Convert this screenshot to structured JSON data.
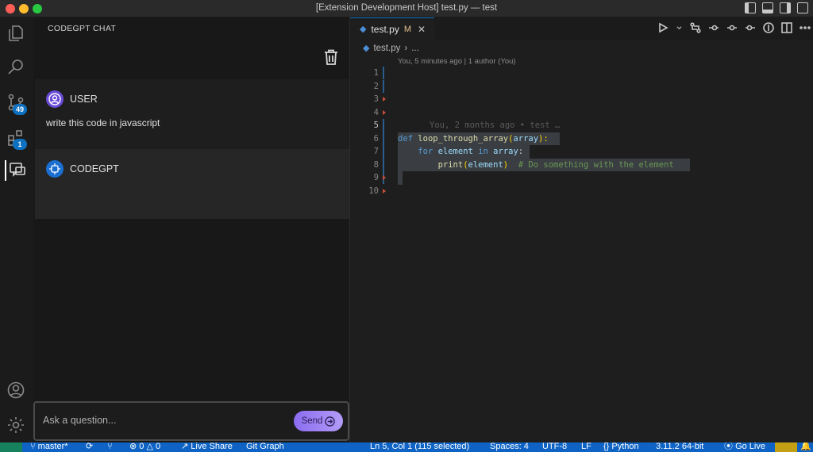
{
  "window": {
    "title": "[Extension Development Host] test.py — test"
  },
  "activity_bar": {
    "source_control_badge": "49",
    "extensions_badge": "1"
  },
  "chat_panel": {
    "title": "CODEGPT CHAT",
    "messages": [
      {
        "author": "USER",
        "text": "write this code in javascript"
      },
      {
        "author": "CODEGPT",
        "text": ""
      }
    ],
    "input_placeholder": "Ask a question...",
    "send_label": "Send"
  },
  "editor": {
    "tab": {
      "filename": "test.py",
      "modified_marker": "M"
    },
    "breadcrumb": {
      "file": "test.py",
      "rest": "..."
    },
    "blame_header": "You, 5 minutes ago | 1 author (You)",
    "inline_blame": "You, 2 months ago • test …",
    "line_numbers": [
      "1",
      "2",
      "3",
      "4",
      "5",
      "6",
      "7",
      "8",
      "9",
      "10"
    ],
    "code_lines": {
      "l6": {
        "kw": "def",
        "fn": "loop_through_array",
        "open": "(",
        "param": "array",
        "close": "):"
      },
      "l7": {
        "indent": "    ",
        "kw": "for",
        "var": "element",
        "kw2": "in",
        "iter": "array",
        "colon": ":"
      },
      "l8": {
        "indent": "        ",
        "fn": "print",
        "open": "(",
        "arg": "element",
        "close": ")",
        "comment": "# Do something with the element"
      }
    }
  },
  "status_bar": {
    "branch": "master*",
    "problems": "0",
    "warnings": "0",
    "live_share": "Live Share",
    "git_graph": "Git Graph",
    "position": "Ln 5, Col 1 (115 selected)",
    "spaces": "Spaces: 4",
    "encoding": "UTF-8",
    "eol": "LF",
    "language": "Python",
    "interpreter": "3.11.2 64-bit",
    "go_live": "Go Live"
  },
  "colors": {
    "status_bar": "#0e63c4",
    "send_button": "#9b80f2",
    "user_avatar": "#6a4bd8",
    "bot_avatar": "#1a6fd0"
  }
}
